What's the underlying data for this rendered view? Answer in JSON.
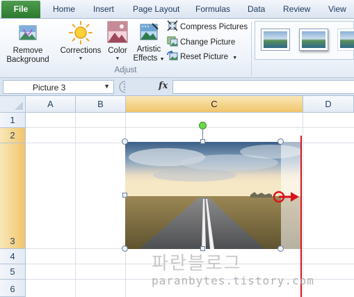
{
  "tabs": [
    {
      "label": "File"
    },
    {
      "label": "Home"
    },
    {
      "label": "Insert"
    },
    {
      "label": "Page Layout"
    },
    {
      "label": "Formulas"
    },
    {
      "label": "Data"
    },
    {
      "label": "Review"
    },
    {
      "label": "View"
    }
  ],
  "ribbon": {
    "remove_background": {
      "line1": "Remove",
      "line2": "Background"
    },
    "corrections": "Corrections",
    "color": "Color",
    "artistic_effects": {
      "line1": "Artistic",
      "line2": "Effects"
    },
    "compress_pictures": "Compress Pictures",
    "change_picture": "Change Picture",
    "reset_picture": "Reset Picture",
    "group_label": "Adjust"
  },
  "formula_bar": {
    "name_box_value": "Picture 3",
    "fx_label": "fx",
    "formula_value": ""
  },
  "columns": [
    "A",
    "B",
    "C",
    "D"
  ],
  "rows": [
    "1",
    "2",
    "3",
    "4",
    "5",
    "6"
  ],
  "watermark": {
    "korean": "파란블로그",
    "url": "paranbytes.tistory.com"
  },
  "colors": {
    "file_tab": "#2b7a2e",
    "selected_header": "#f1c56a",
    "crop_line": "#d8121b",
    "rotate_handle": "#6dd74b"
  }
}
